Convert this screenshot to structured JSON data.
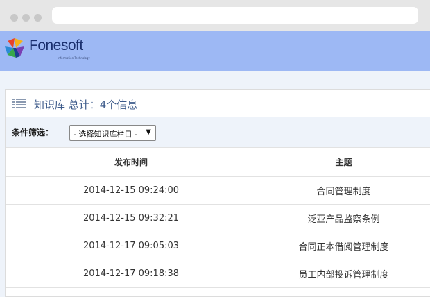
{
  "brand": {
    "name": "Fonesoft",
    "tagline": "Information Technology",
    "header_color": "#9db8f4"
  },
  "panel": {
    "title": "知识库 总计：4个信息"
  },
  "filter": {
    "label": "条件筛选：",
    "selected_option": "- 选择知识库栏目 -"
  },
  "table": {
    "headers": [
      "发布时间",
      "主题"
    ],
    "rows": [
      {
        "date": "2014-12-15 09:24:00",
        "subject": "合同管理制度"
      },
      {
        "date": "2014-12-15 09:32:21",
        "subject": "泛亚产品监察条例"
      },
      {
        "date": "2014-12-17 09:05:03",
        "subject": "合同正本借阅管理制度"
      },
      {
        "date": "2014-12-17 09:18:38",
        "subject": "员工内部投诉管理制度"
      }
    ]
  }
}
